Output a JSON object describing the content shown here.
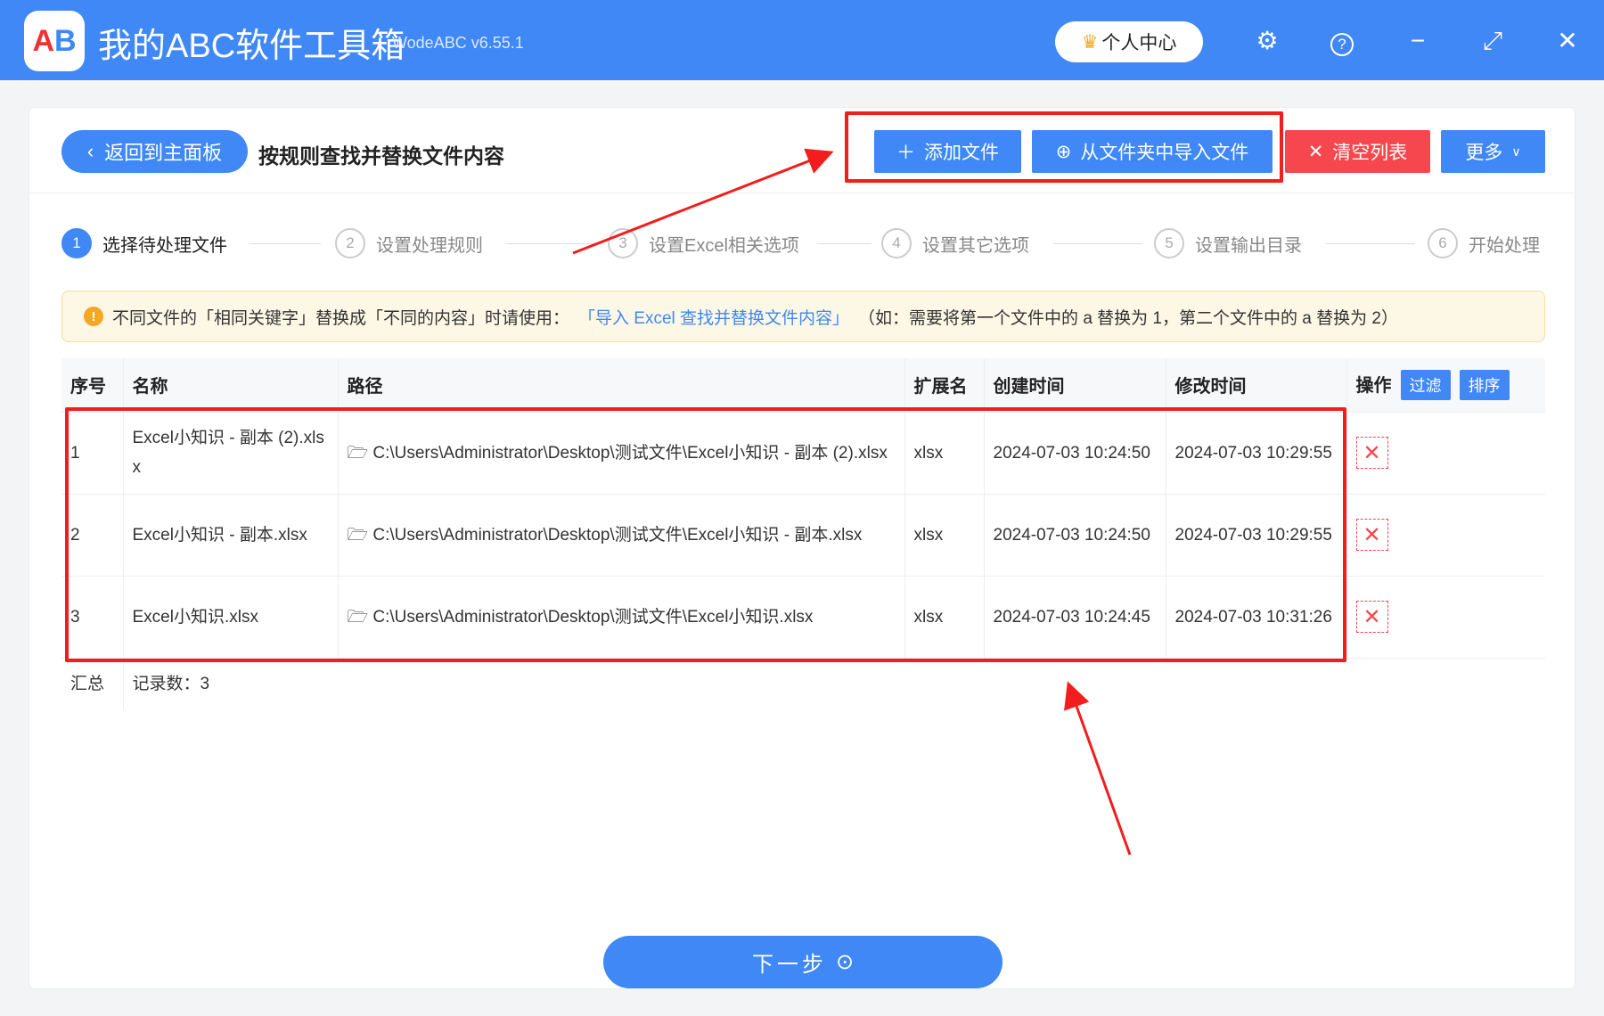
{
  "app": {
    "title": "我的ABC软件工具箱",
    "version": "WodeABC v6.55.1",
    "logo": "AB",
    "user_center": "个人中心"
  },
  "toolbar": {
    "back": "返回到主面板",
    "page_title": "按规则查找并替换文件内容",
    "add_file": "添加文件",
    "import_folder": "从文件夹中导入文件",
    "clear_list": "清空列表",
    "more": "更多"
  },
  "steps": [
    {
      "n": "1",
      "label": "选择待处理文件"
    },
    {
      "n": "2",
      "label": "设置处理规则"
    },
    {
      "n": "3",
      "label": "设置Excel相关选项"
    },
    {
      "n": "4",
      "label": "设置其它选项"
    },
    {
      "n": "5",
      "label": "设置输出目录"
    },
    {
      "n": "6",
      "label": "开始处理"
    }
  ],
  "notice": {
    "prefix": "不同文件的「相同关键字」替换成「不同的内容」时请使用：",
    "link": "「导入 Excel 查找并替换文件内容」",
    "suffix": "（如：需要将第一个文件中的 a 替换为 1，第二个文件中的 a 替换为 2）"
  },
  "table": {
    "headers": {
      "idx": "序号",
      "name": "名称",
      "path": "路径",
      "ext": "扩展名",
      "created": "创建时间",
      "modified": "修改时间",
      "ops": "操作",
      "filter": "过滤",
      "sort": "排序"
    },
    "rows": [
      {
        "idx": "1",
        "name": "Excel小知识 - 副本 (2).xlsx",
        "path": "C:\\Users\\Administrator\\Desktop\\测试文件\\Excel小知识 - 副本 (2).xlsx",
        "ext": "xlsx",
        "created": "2024-07-03 10:24:50",
        "modified": "2024-07-03 10:29:55"
      },
      {
        "idx": "2",
        "name": "Excel小知识 - 副本.xlsx",
        "path": "C:\\Users\\Administrator\\Desktop\\测试文件\\Excel小知识 - 副本.xlsx",
        "ext": "xlsx",
        "created": "2024-07-03 10:24:50",
        "modified": "2024-07-03 10:29:55"
      },
      {
        "idx": "3",
        "name": "Excel小知识.xlsx",
        "path": "C:\\Users\\Administrator\\Desktop\\测试文件\\Excel小知识.xlsx",
        "ext": "xlsx",
        "created": "2024-07-03 10:24:45",
        "modified": "2024-07-03 10:31:26"
      }
    ],
    "summary_label": "汇总",
    "summary_count": "记录数：3"
  },
  "next": "下一步"
}
